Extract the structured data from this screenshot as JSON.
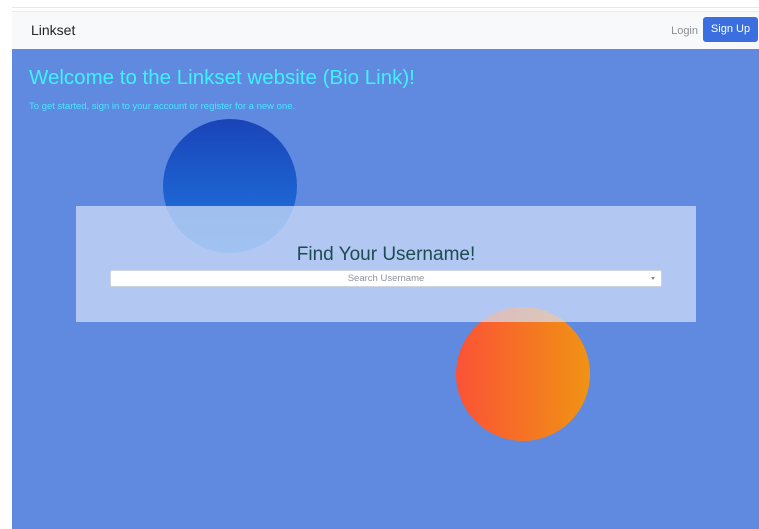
{
  "navbar": {
    "brand": "Linkset",
    "login_label": "Login",
    "signup_label": "Sign Up"
  },
  "hero": {
    "title": "Welcome to the Linkset website (Bio Link)!",
    "subtitle": "To get started, sign in to your account or register for a new one."
  },
  "search_card": {
    "title": "Find Your Username!",
    "placeholder": "Search Username"
  },
  "colors": {
    "hero_background": "#5f8ae0",
    "title_text": "#3ef2ff",
    "signup_button": "#3b6fe0",
    "circle_blue": "#1a44b8",
    "circle_orange": "#f56a2a"
  },
  "icons": {
    "dropdown": "caret-down-icon"
  }
}
